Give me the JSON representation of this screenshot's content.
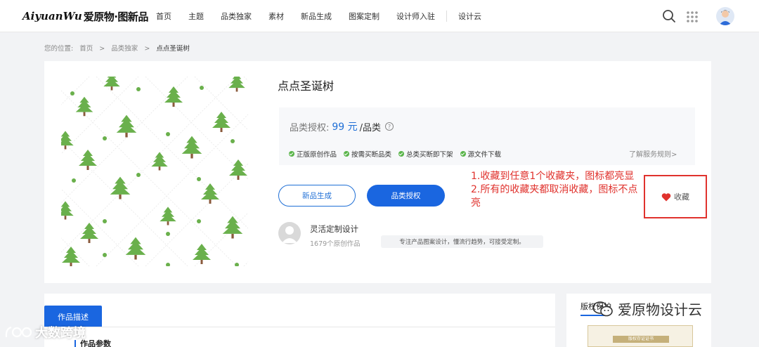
{
  "header": {
    "logo_script": "AiyuanWu",
    "logo_cn": "爱原物·图新品",
    "nav": [
      "首页",
      "主题",
      "品类独家",
      "素材",
      "新品生成",
      "图案定制",
      "设计师入驻",
      "设计云"
    ]
  },
  "breadcrumb": {
    "prefix": "您的位置:",
    "items": [
      "首页",
      ">",
      "品类独家",
      ">",
      "点点圣诞树"
    ]
  },
  "product": {
    "title": "点点圣诞树",
    "price_label": "品类授权:",
    "price": "99 元",
    "price_unit": "/品类",
    "features": [
      "正版原创作品",
      "按需买断品类",
      "总类买断即下架",
      "源文件下载"
    ],
    "rules_link": "了解服务规则>",
    "btn_generate": "新品生成",
    "btn_license": "品类授权",
    "favorite_label": "收藏"
  },
  "annotation": {
    "line1": "1.收藏到任意1个收藏夹，图标都亮显",
    "line2": "2.所有的收藏夹都取消收藏，图标不点亮"
  },
  "designer": {
    "name": "灵活定制设计",
    "works": "1679个原创作品",
    "tag": "专注产品图案设计，懂流行趋势，可接受定制。"
  },
  "description": {
    "tab": "作品描述",
    "subheading": "作品参数"
  },
  "sidebar": {
    "title": "版权保护",
    "cert_text": "版权存证证书"
  },
  "watermarks": {
    "left": "大数跨境",
    "right": "爱原物设计云"
  },
  "colors": {
    "accent": "#1a66e0",
    "annotation_red": "#e0322d",
    "tree_green": "#6ab04c"
  }
}
